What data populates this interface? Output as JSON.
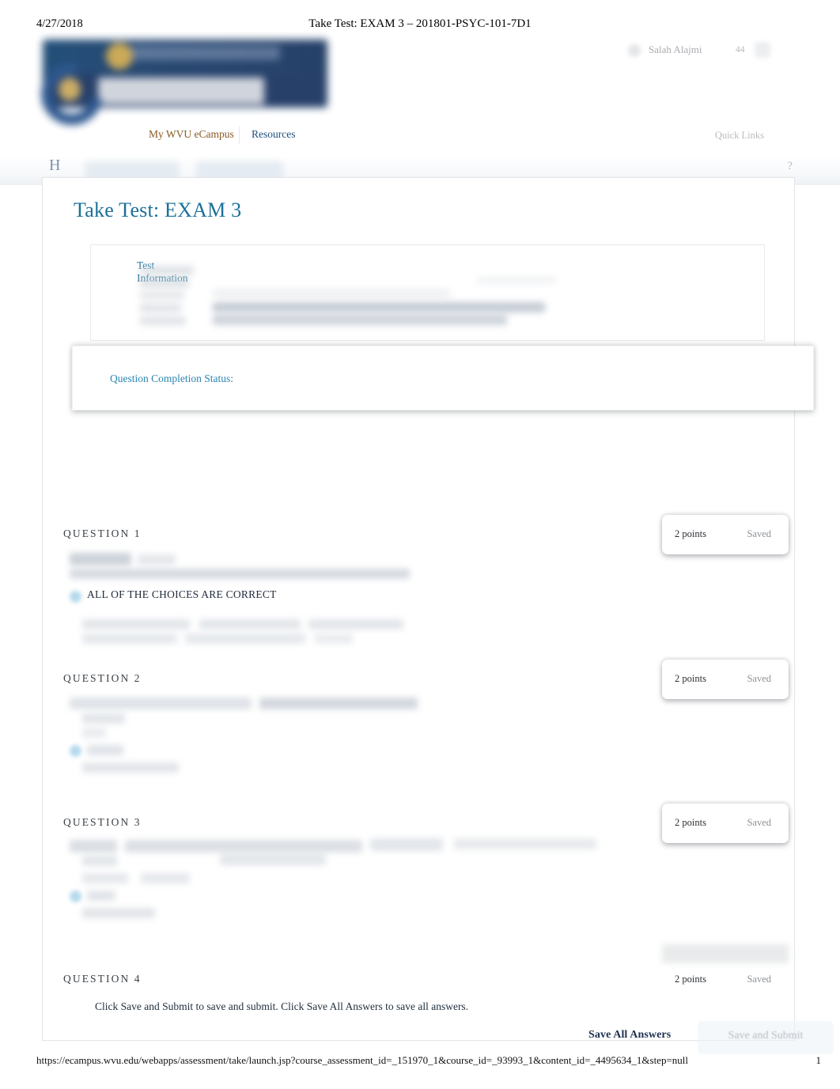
{
  "print": {
    "date": "4/27/2018",
    "title": "Take Test: EXAM 3 – 201801-PSYC-101-7D1",
    "footer_url": "https://ecampus.wvu.edu/webapps/assessment/take/launch.jsp?course_assessment_id=_151970_1&course_id=_93993_1&content_id=_4495634_1&step=null",
    "page_number": "1"
  },
  "chrome": {
    "logo_alt": "WVU eCampus",
    "nav": [
      {
        "label": "My WVU eCampus",
        "color": "#8a5a23"
      },
      {
        "label": "Resources",
        "color": "#1d4e7e"
      }
    ],
    "quick_links": "Quick Links",
    "user_name": "Salah Alajmi",
    "notification_count": "44",
    "home_glyph": "H",
    "help_glyph": "?"
  },
  "card": {
    "title": "Take Test: EXAM 3",
    "test_information_label": "Test Information",
    "question_completion_status_label": "Question Completion Status:"
  },
  "questions": [
    {
      "label": "QUESTION 1",
      "points": "2 points",
      "status": "Saved",
      "selected_answer": "ALL OF THE CHOICES ARE CORRECT"
    },
    {
      "label": "QUESTION 2",
      "points": "2 points",
      "status": "Saved",
      "selected_answer": ""
    },
    {
      "label": "QUESTION 3",
      "points": "2 points",
      "status": "Saved",
      "selected_answer": ""
    },
    {
      "label": "QUESTION 4",
      "points": "2 points",
      "status": "Saved",
      "selected_answer": ""
    }
  ],
  "footer": {
    "note": "Click Save and Submit to save and submit. Click Save All Answers to save all answers.",
    "save_all_label": "Save All Answers",
    "save_submit_label": "Save and Submit"
  },
  "colors": {
    "heading_blue": "#1b7099",
    "link_blue": "#1d4e7e",
    "nav_orange": "#8a5a23",
    "radio_selected": "#a9d3ea"
  }
}
